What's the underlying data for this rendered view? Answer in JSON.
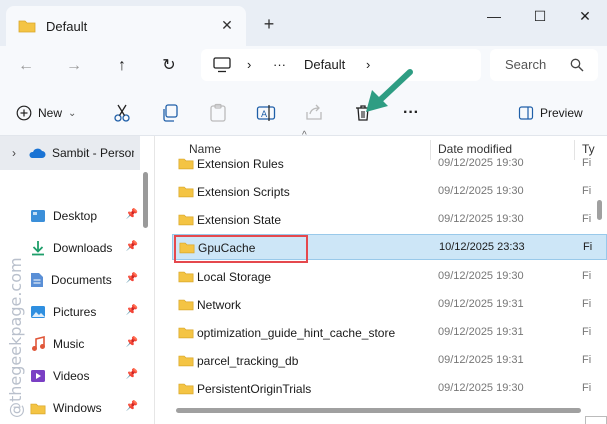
{
  "window": {
    "tab_title": "Default",
    "tab_close_glyph": "✕",
    "new_tab_glyph": "+",
    "minimize_glyph": "—",
    "maximize_glyph": "☐",
    "close_glyph": "✕"
  },
  "address": {
    "back_glyph": "←",
    "forward_glyph": "→",
    "up_glyph": "↑",
    "refresh_glyph": "↻",
    "separator_glyph": "›",
    "overflow": "···",
    "crumb": "Default",
    "search_placeholder": "Search"
  },
  "toolbar": {
    "new_label": "New",
    "new_dropdown_glyph": "⌄",
    "more_glyph": "···",
    "preview_label": "Preview"
  },
  "sidebar": {
    "top_item": {
      "label": "Sambit - Personal",
      "chevron": "›"
    },
    "pin_glyph": "📌",
    "items": [
      {
        "label": "Desktop",
        "icon": "desktop-icon"
      },
      {
        "label": "Downloads",
        "icon": "downloads-icon"
      },
      {
        "label": "Documents",
        "icon": "documents-icon"
      },
      {
        "label": "Pictures",
        "icon": "pictures-icon"
      },
      {
        "label": "Music",
        "icon": "music-icon"
      },
      {
        "label": "Videos",
        "icon": "videos-icon"
      },
      {
        "label": "Windows",
        "icon": "folder-icon"
      }
    ]
  },
  "watermark": "@thegeekpage.com",
  "files": {
    "sort_glyph": "^",
    "columns": {
      "name": "Name",
      "date": "Date modified",
      "type": "Ty"
    },
    "rows": [
      {
        "name": "Extension Rules",
        "date": "09/12/2025 19:30",
        "type": "Fi"
      },
      {
        "name": "Extension Scripts",
        "date": "09/12/2025 19:30",
        "type": "Fi"
      },
      {
        "name": "Extension State",
        "date": "09/12/2025 19:30",
        "type": "Fi"
      },
      {
        "name": "GpuCache",
        "date": "10/12/2025 23:33",
        "type": "Fi",
        "selected": true
      },
      {
        "name": "Local Storage",
        "date": "09/12/2025 19:30",
        "type": "Fi"
      },
      {
        "name": "Network",
        "date": "09/12/2025 19:31",
        "type": "Fi"
      },
      {
        "name": "optimization_guide_hint_cache_store",
        "date": "09/12/2025 19:31",
        "type": "Fi"
      },
      {
        "name": "parcel_tracking_db",
        "date": "09/12/2025 19:31",
        "type": "Fi"
      },
      {
        "name": "PersistentOriginTrials",
        "date": "09/12/2025 19:30",
        "type": "Fi"
      }
    ]
  },
  "colors": {
    "folder": "#f4c444",
    "selection": "#cde6f7",
    "highlight_box": "#e5484d",
    "annotation_arrow": "#2e9d83",
    "cloud": "#1a73d4"
  }
}
